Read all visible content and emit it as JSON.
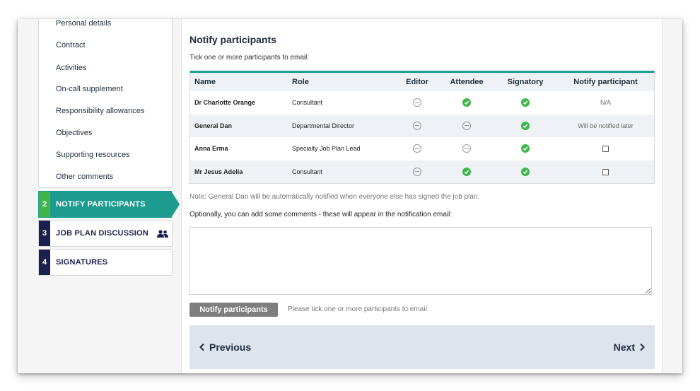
{
  "sidebar": {
    "sub_items": [
      "Personal details",
      "Contract",
      "Activities",
      "On-call supplement",
      "Responsibility allowances",
      "Objectives",
      "Supporting resources",
      "Other comments"
    ],
    "steps": [
      {
        "num": "2",
        "label": "NOTIFY PARTICIPANTS",
        "active": true
      },
      {
        "num": "3",
        "label": "JOB PLAN DISCUSSION",
        "icon": "people-icon"
      },
      {
        "num": "4",
        "label": "SIGNATURES"
      }
    ]
  },
  "main": {
    "title": "Notify participants",
    "subtitle": "Tick one or more participants to email:",
    "table": {
      "headers": [
        "Name",
        "Role",
        "Editor",
        "Attendee",
        "Signatory",
        "Notify participant"
      ],
      "rows": [
        {
          "name": "Dr Charlotte Orange",
          "role": "Consultant",
          "editor": "no",
          "attendee": "yes",
          "signatory": "yes",
          "notify": "N/A"
        },
        {
          "name": "General Dan",
          "role": "Departmental Director",
          "editor": "no",
          "attendee": "no",
          "signatory": "yes",
          "notify": "Will be notified later"
        },
        {
          "name": "Anna Erma",
          "role": "Specialty Job Plan Lead",
          "editor": "no",
          "attendee": "no",
          "signatory": "yes",
          "notify": "checkbox"
        },
        {
          "name": "Mr Jesus Adelia",
          "role": "Consultant",
          "editor": "no",
          "attendee": "yes",
          "signatory": "yes",
          "notify": "checkbox"
        }
      ]
    },
    "note": "Note: General Dan will be automatically notified when everyone else has signed the job plan.",
    "optional_label": "Optionally, you can add some comments - these will appear in the notification email:",
    "comment_value": "",
    "notify_button": "Notify participants",
    "hint": "Please tick one or more participants to email",
    "previous_label": "Previous",
    "next_label": "Next"
  },
  "colors": {
    "teal": "#1d9b8e",
    "green": "#3fb54b",
    "navy": "#1b1f4d",
    "pager_bg": "#dde4ec"
  }
}
